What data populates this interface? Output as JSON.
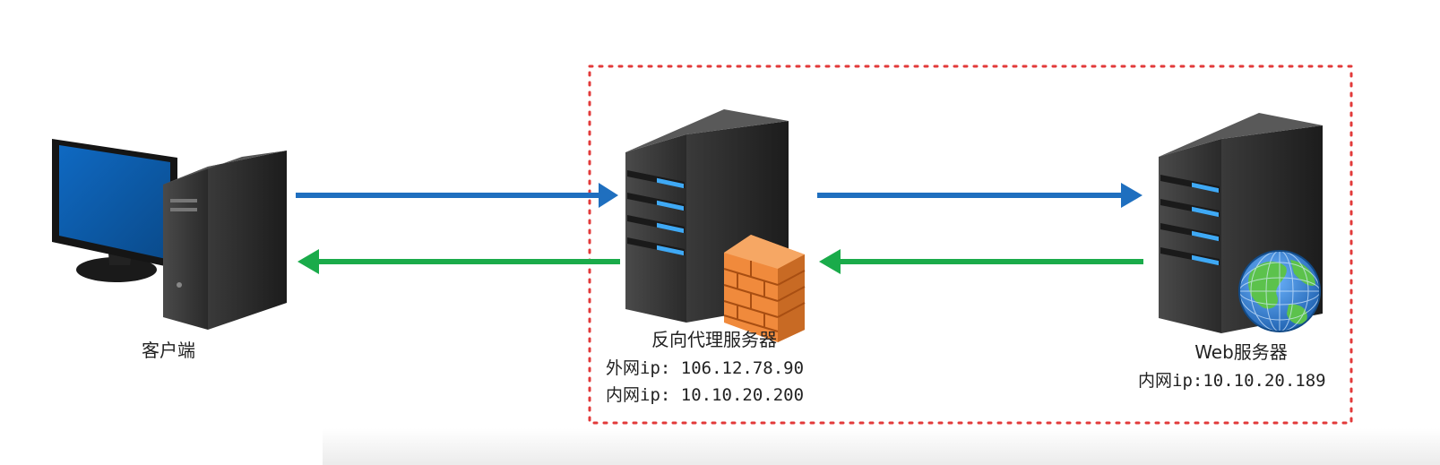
{
  "nodes": {
    "client": {
      "label": "客户端"
    },
    "proxy": {
      "label": "反向代理服务器",
      "external_ip": "外网ip: 106.12.78.90",
      "internal_ip": "内网ip: 10.10.20.200"
    },
    "web": {
      "label": "Web服务器",
      "internal_ip": "内网ip:10.10.20.189"
    }
  },
  "colors": {
    "request_arrow": "#1f6fbf",
    "response_arrow": "#1aab4a",
    "boundary": "#e23a3a",
    "screen": "#0d5aa7",
    "server_body": "#2b2b2b",
    "led": "#3fa9f5",
    "firewall": "#f08a3c",
    "globe_water": "#2a7fd4",
    "globe_land": "#5cc24c"
  },
  "icons": {
    "client": "desktop-computer-icon",
    "proxy": "server-tower-icon",
    "firewall": "firewall-brick-icon",
    "web": "server-tower-icon",
    "globe": "globe-icon"
  }
}
